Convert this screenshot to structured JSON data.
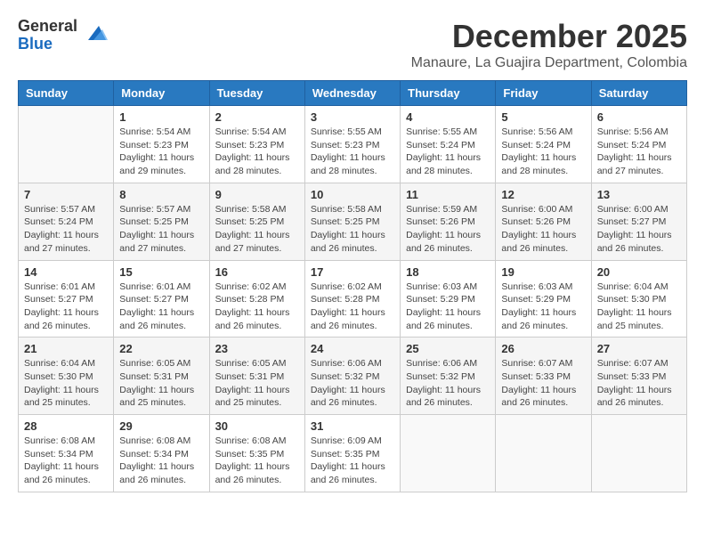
{
  "header": {
    "logo_general": "General",
    "logo_blue": "Blue",
    "month_title": "December 2025",
    "location": "Manaure, La Guajira Department, Colombia"
  },
  "weekdays": [
    "Sunday",
    "Monday",
    "Tuesday",
    "Wednesday",
    "Thursday",
    "Friday",
    "Saturday"
  ],
  "weeks": [
    [
      {
        "day": "",
        "info": ""
      },
      {
        "day": "1",
        "info": "Sunrise: 5:54 AM\nSunset: 5:23 PM\nDaylight: 11 hours\nand 29 minutes."
      },
      {
        "day": "2",
        "info": "Sunrise: 5:54 AM\nSunset: 5:23 PM\nDaylight: 11 hours\nand 28 minutes."
      },
      {
        "day": "3",
        "info": "Sunrise: 5:55 AM\nSunset: 5:23 PM\nDaylight: 11 hours\nand 28 minutes."
      },
      {
        "day": "4",
        "info": "Sunrise: 5:55 AM\nSunset: 5:24 PM\nDaylight: 11 hours\nand 28 minutes."
      },
      {
        "day": "5",
        "info": "Sunrise: 5:56 AM\nSunset: 5:24 PM\nDaylight: 11 hours\nand 28 minutes."
      },
      {
        "day": "6",
        "info": "Sunrise: 5:56 AM\nSunset: 5:24 PM\nDaylight: 11 hours\nand 27 minutes."
      }
    ],
    [
      {
        "day": "7",
        "info": "Sunrise: 5:57 AM\nSunset: 5:24 PM\nDaylight: 11 hours\nand 27 minutes."
      },
      {
        "day": "8",
        "info": "Sunrise: 5:57 AM\nSunset: 5:25 PM\nDaylight: 11 hours\nand 27 minutes."
      },
      {
        "day": "9",
        "info": "Sunrise: 5:58 AM\nSunset: 5:25 PM\nDaylight: 11 hours\nand 27 minutes."
      },
      {
        "day": "10",
        "info": "Sunrise: 5:58 AM\nSunset: 5:25 PM\nDaylight: 11 hours\nand 26 minutes."
      },
      {
        "day": "11",
        "info": "Sunrise: 5:59 AM\nSunset: 5:26 PM\nDaylight: 11 hours\nand 26 minutes."
      },
      {
        "day": "12",
        "info": "Sunrise: 6:00 AM\nSunset: 5:26 PM\nDaylight: 11 hours\nand 26 minutes."
      },
      {
        "day": "13",
        "info": "Sunrise: 6:00 AM\nSunset: 5:27 PM\nDaylight: 11 hours\nand 26 minutes."
      }
    ],
    [
      {
        "day": "14",
        "info": "Sunrise: 6:01 AM\nSunset: 5:27 PM\nDaylight: 11 hours\nand 26 minutes."
      },
      {
        "day": "15",
        "info": "Sunrise: 6:01 AM\nSunset: 5:27 PM\nDaylight: 11 hours\nand 26 minutes."
      },
      {
        "day": "16",
        "info": "Sunrise: 6:02 AM\nSunset: 5:28 PM\nDaylight: 11 hours\nand 26 minutes."
      },
      {
        "day": "17",
        "info": "Sunrise: 6:02 AM\nSunset: 5:28 PM\nDaylight: 11 hours\nand 26 minutes."
      },
      {
        "day": "18",
        "info": "Sunrise: 6:03 AM\nSunset: 5:29 PM\nDaylight: 11 hours\nand 26 minutes."
      },
      {
        "day": "19",
        "info": "Sunrise: 6:03 AM\nSunset: 5:29 PM\nDaylight: 11 hours\nand 26 minutes."
      },
      {
        "day": "20",
        "info": "Sunrise: 6:04 AM\nSunset: 5:30 PM\nDaylight: 11 hours\nand 25 minutes."
      }
    ],
    [
      {
        "day": "21",
        "info": "Sunrise: 6:04 AM\nSunset: 5:30 PM\nDaylight: 11 hours\nand 25 minutes."
      },
      {
        "day": "22",
        "info": "Sunrise: 6:05 AM\nSunset: 5:31 PM\nDaylight: 11 hours\nand 25 minutes."
      },
      {
        "day": "23",
        "info": "Sunrise: 6:05 AM\nSunset: 5:31 PM\nDaylight: 11 hours\nand 25 minutes."
      },
      {
        "day": "24",
        "info": "Sunrise: 6:06 AM\nSunset: 5:32 PM\nDaylight: 11 hours\nand 26 minutes."
      },
      {
        "day": "25",
        "info": "Sunrise: 6:06 AM\nSunset: 5:32 PM\nDaylight: 11 hours\nand 26 minutes."
      },
      {
        "day": "26",
        "info": "Sunrise: 6:07 AM\nSunset: 5:33 PM\nDaylight: 11 hours\nand 26 minutes."
      },
      {
        "day": "27",
        "info": "Sunrise: 6:07 AM\nSunset: 5:33 PM\nDaylight: 11 hours\nand 26 minutes."
      }
    ],
    [
      {
        "day": "28",
        "info": "Sunrise: 6:08 AM\nSunset: 5:34 PM\nDaylight: 11 hours\nand 26 minutes."
      },
      {
        "day": "29",
        "info": "Sunrise: 6:08 AM\nSunset: 5:34 PM\nDaylight: 11 hours\nand 26 minutes."
      },
      {
        "day": "30",
        "info": "Sunrise: 6:08 AM\nSunset: 5:35 PM\nDaylight: 11 hours\nand 26 minutes."
      },
      {
        "day": "31",
        "info": "Sunrise: 6:09 AM\nSunset: 5:35 PM\nDaylight: 11 hours\nand 26 minutes."
      },
      {
        "day": "",
        "info": ""
      },
      {
        "day": "",
        "info": ""
      },
      {
        "day": "",
        "info": ""
      }
    ]
  ]
}
